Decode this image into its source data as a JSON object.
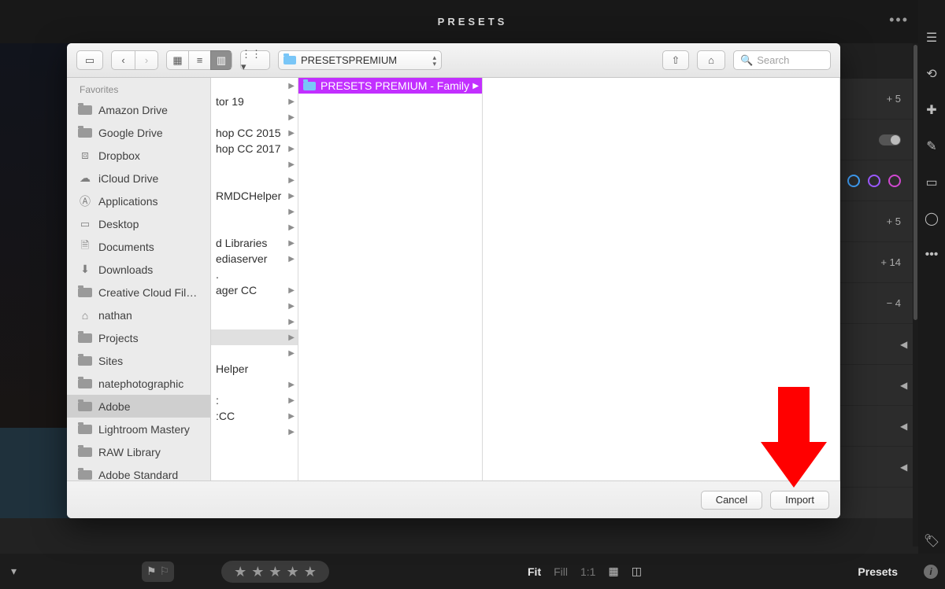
{
  "lr": {
    "presets_title": "PRESETS",
    "footer": {
      "fit": "Fit",
      "fill": "Fill",
      "one": "1:1",
      "presets": "Presets"
    },
    "panel_values": {
      "v1": "+ 5",
      "v2": "+ 5",
      "v3": "+ 14",
      "v4": "− 4"
    },
    "circle_colors": [
      "#42a5ff",
      "#9b59ff",
      "#d048d0"
    ]
  },
  "finder": {
    "path_label": "PRESETSPREMIUM",
    "search_placeholder": "Search",
    "sidebar_section": "Favorites",
    "sidebar": [
      {
        "icon": "folder",
        "label": "Amazon Drive"
      },
      {
        "icon": "folder",
        "label": "Google Drive"
      },
      {
        "icon": "dropbox",
        "label": "Dropbox"
      },
      {
        "icon": "cloud",
        "label": "iCloud Drive"
      },
      {
        "icon": "apps",
        "label": "Applications"
      },
      {
        "icon": "desktop",
        "label": "Desktop"
      },
      {
        "icon": "doc",
        "label": "Documents"
      },
      {
        "icon": "download",
        "label": "Downloads"
      },
      {
        "icon": "folder",
        "label": "Creative Cloud Fil…"
      },
      {
        "icon": "home",
        "label": "nathan"
      },
      {
        "icon": "folder",
        "label": "Projects"
      },
      {
        "icon": "folder",
        "label": "Sites"
      },
      {
        "icon": "folder",
        "label": "natephotographic"
      },
      {
        "icon": "folder",
        "label": "Adobe",
        "selected": true
      },
      {
        "icon": "folder",
        "label": "Lightroom Mastery"
      },
      {
        "icon": "folder",
        "label": "RAW Library"
      },
      {
        "icon": "folder",
        "label": "Adobe Standard"
      }
    ],
    "col1": [
      {
        "label": "",
        "arrow": true
      },
      {
        "label": "tor 19",
        "arrow": true
      },
      {
        "label": "",
        "arrow": true
      },
      {
        "label": "hop CC 2015",
        "arrow": true
      },
      {
        "label": "hop CC 2017",
        "arrow": true
      },
      {
        "label": "",
        "arrow": true
      },
      {
        "label": "",
        "arrow": true
      },
      {
        "label": "RMDCHelper",
        "arrow": true
      },
      {
        "label": "",
        "arrow": true
      },
      {
        "label": "",
        "arrow": true
      },
      {
        "label": "d Libraries",
        "arrow": true
      },
      {
        "label": "ediaserver",
        "arrow": true
      },
      {
        "label": ".",
        "arrow": false
      },
      {
        "label": "ager CC",
        "arrow": true
      },
      {
        "label": "",
        "arrow": true
      },
      {
        "label": "",
        "arrow": true
      },
      {
        "label": "",
        "arrow": true,
        "selected": true
      },
      {
        "label": "",
        "arrow": true
      },
      {
        "label": "Helper",
        "arrow": false
      },
      {
        "label": "",
        "arrow": true
      },
      {
        "label": ":",
        "arrow": true
      },
      {
        "label": ":CC",
        "arrow": true
      },
      {
        "label": "",
        "arrow": true
      }
    ],
    "col2": [
      {
        "label": "PRESETS PREMIUM - Family",
        "arrow": true,
        "selected": true
      }
    ],
    "buttons": {
      "cancel": "Cancel",
      "import": "Import"
    }
  }
}
